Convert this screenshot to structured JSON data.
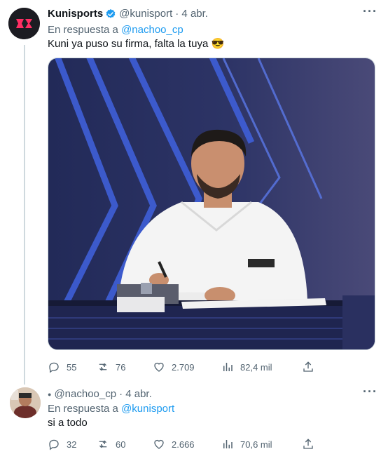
{
  "tweets": [
    {
      "display_name": "Kunisports",
      "handle": "@kunisport",
      "date": "· 4 abr.",
      "reply_prefix": "En respuesta a",
      "reply_to": "@nachoo_cp",
      "text": "Kuni ya puso su firma, falta la tuya 😎",
      "stats": {
        "replies": "55",
        "retweets": "76",
        "likes": "2.709",
        "views": "82,4 mil"
      }
    },
    {
      "display_name": "",
      "handle": "@nachoo_cp",
      "date": "· 4 abr.",
      "reply_prefix": "En respuesta a",
      "reply_to": "@kunisport",
      "text": "si a todo",
      "stats": {
        "replies": "32",
        "retweets": "60",
        "likes": "2.666",
        "views": "70,6 mil"
      }
    }
  ],
  "more_label": "···",
  "colors": {
    "accent": "#1d9bf0",
    "muted": "#536471",
    "verified": "#1d9bf0",
    "line": "#cfd9de"
  },
  "icons": [
    "reply-icon",
    "retweet-icon",
    "like-icon",
    "views-icon",
    "share-icon",
    "verified-badge-icon",
    "more-icon"
  ]
}
